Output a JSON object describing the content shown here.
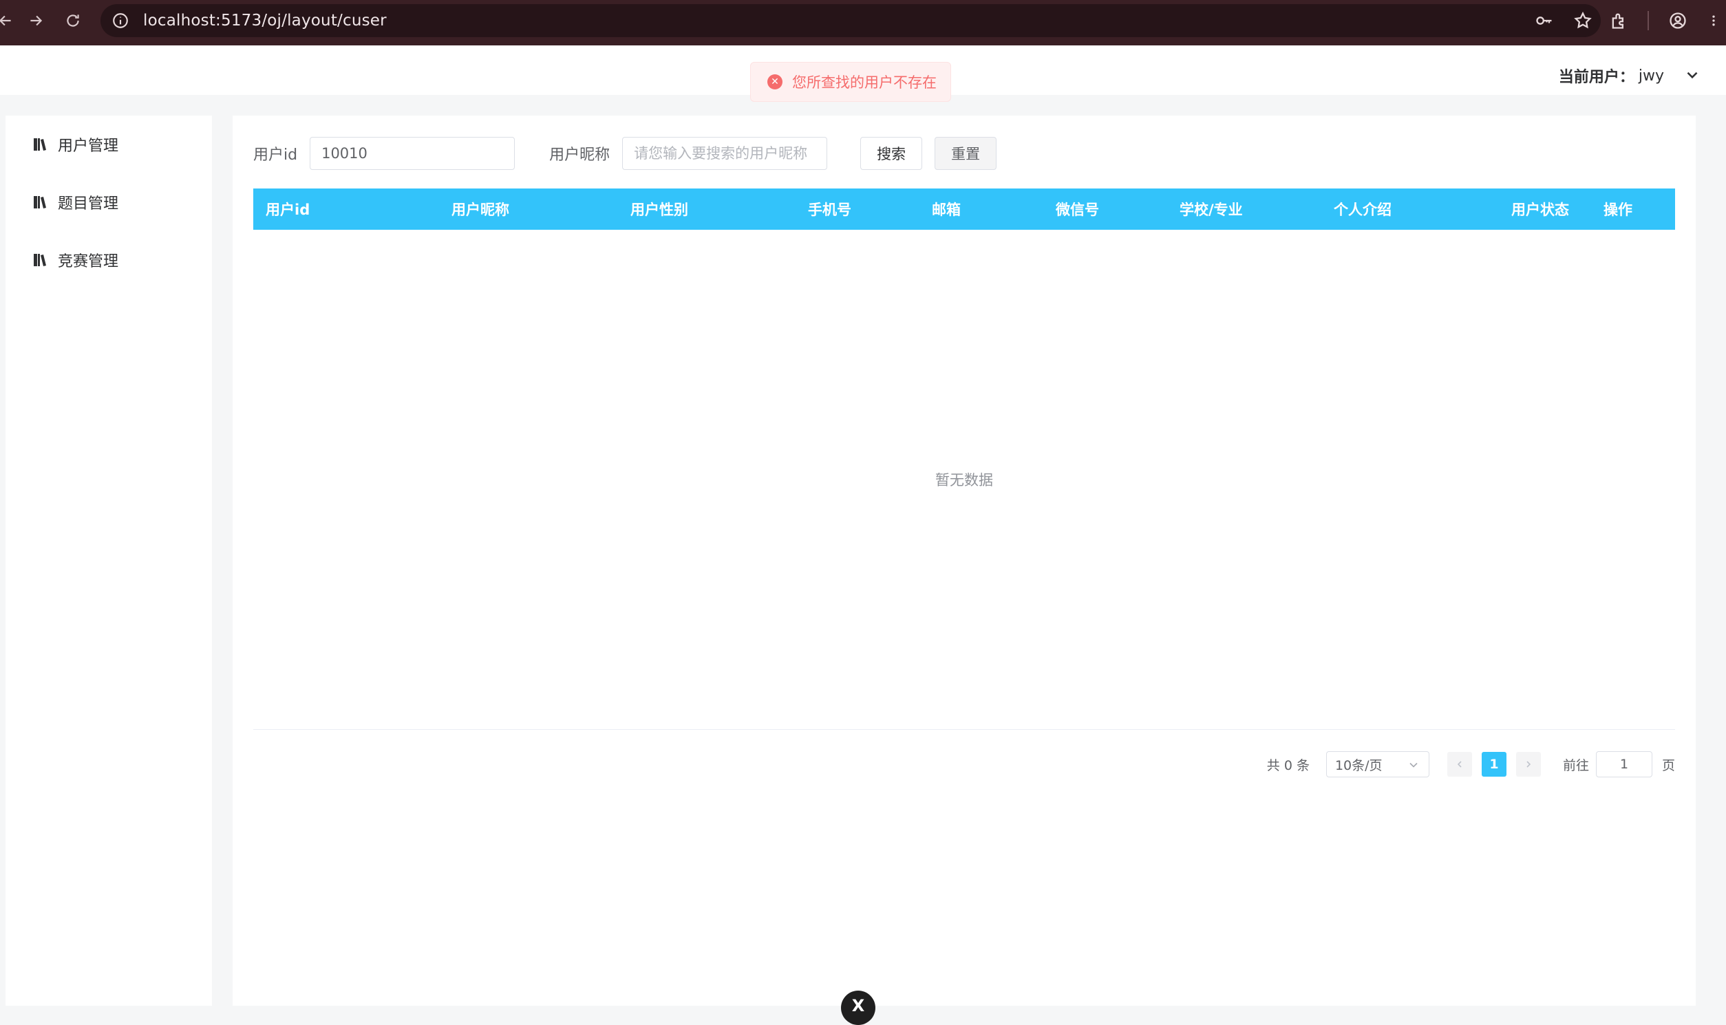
{
  "browser": {
    "url": "localhost:5173/oj/layout/cuser"
  },
  "header": {
    "current_user_label": "当前用户：",
    "current_user_name": "jwy"
  },
  "toast": {
    "message": "您所查找的用户不存在",
    "color": "#f56c6c"
  },
  "sidebar": {
    "items": [
      {
        "label": "用户管理",
        "icon": "book-icon"
      },
      {
        "label": "题目管理",
        "icon": "book-icon"
      },
      {
        "label": "竞赛管理",
        "icon": "book-icon"
      }
    ]
  },
  "search": {
    "user_id_label": "用户id",
    "user_id_value": "10010",
    "nickname_label": "用户昵称",
    "nickname_placeholder": "请您输入要搜索的用户昵称",
    "search_label": "搜索",
    "reset_label": "重置"
  },
  "table": {
    "header_color": "#33c3fa",
    "columns": [
      "用户id",
      "用户昵称",
      "用户性别",
      "手机号",
      "邮箱",
      "微信号",
      "学校/专业",
      "个人介绍",
      "用户状态",
      "操作"
    ],
    "empty_text": "暂无数据"
  },
  "pagination": {
    "total": "共 0 条",
    "page_size": "10条/页",
    "current_page": "1",
    "goto_label": "前往",
    "goto_value": "1",
    "page_suffix": "页"
  },
  "float_button": {
    "glyph": "X"
  }
}
